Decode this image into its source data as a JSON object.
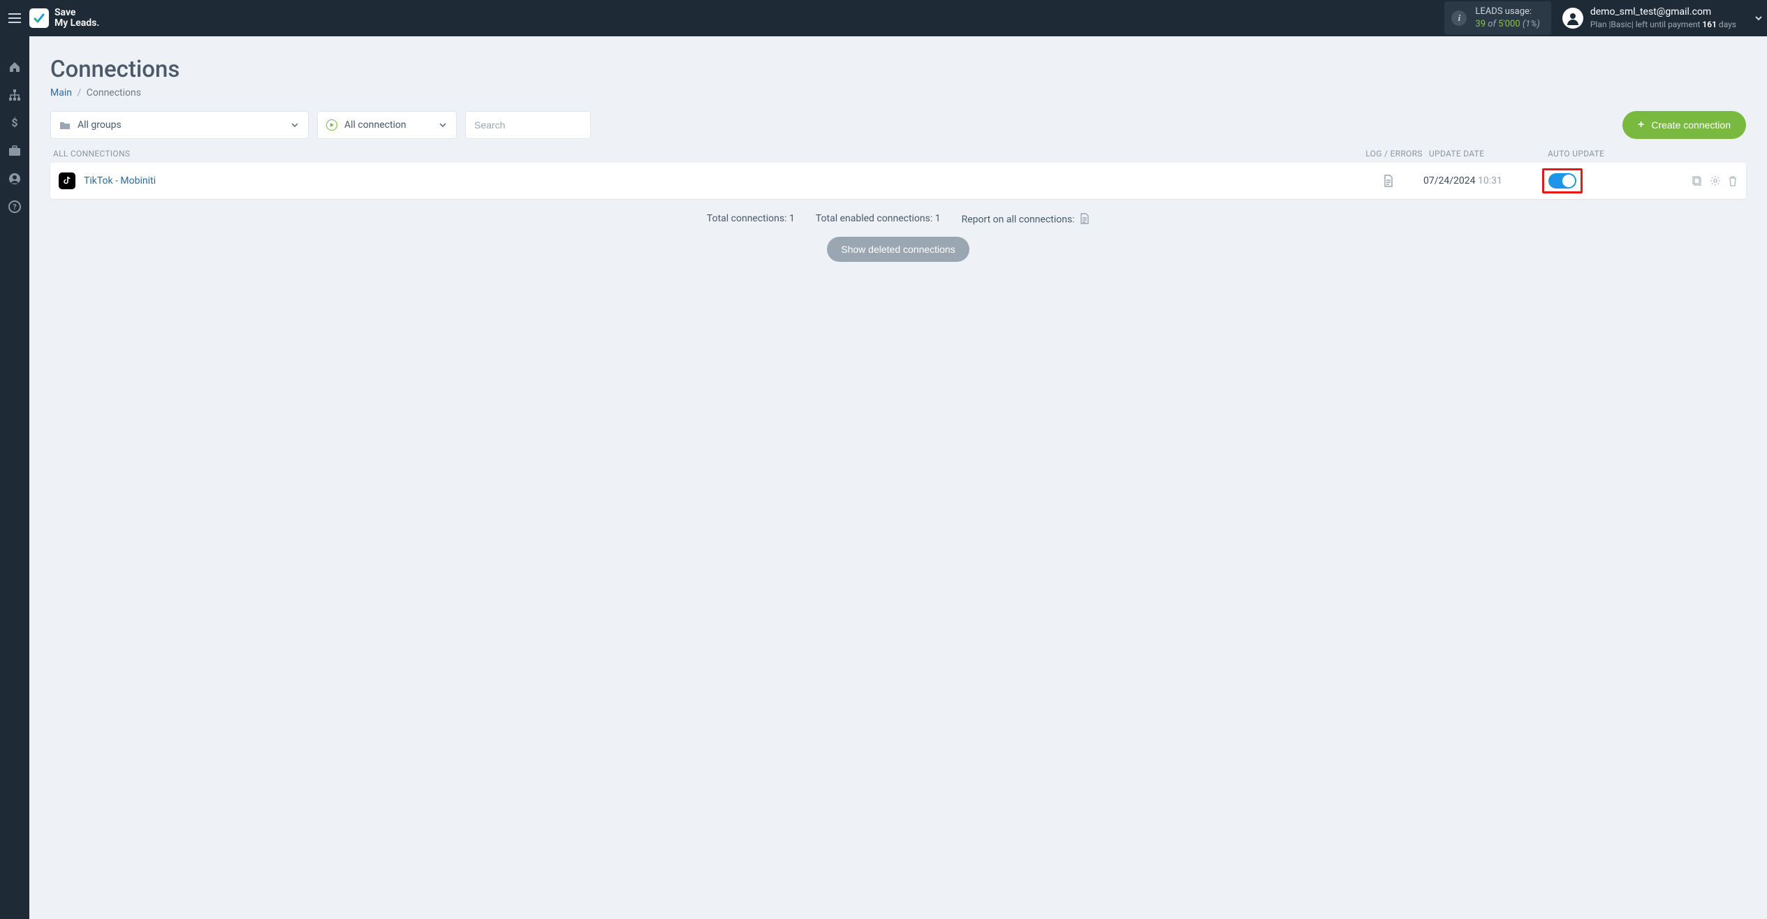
{
  "brand": {
    "line1": "Save",
    "line2": "My Leads."
  },
  "leads": {
    "label": "LEADS usage:",
    "used": "39",
    "of": "of",
    "total": "5'000",
    "pct": "(1%)"
  },
  "account": {
    "email": "demo_sml_test@gmail.com",
    "plan1": "Plan |",
    "plan2": "Basic",
    "plan3": "| left until payment",
    "days_n": "161",
    "days_w": "days"
  },
  "page": {
    "title": "Connections",
    "bc_main": "Main",
    "bc_current": "Connections"
  },
  "filters": {
    "groups": "All groups",
    "state": "All connection",
    "search_ph": "Search",
    "create": "Create connection"
  },
  "columns": {
    "all": "ALL CONNECTIONS",
    "log": "LOG / ERRORS",
    "date": "UPDATE DATE",
    "auto": "AUTO UPDATE"
  },
  "rows": [
    {
      "name": "TikTok - Mobiniti",
      "icon_lbl": "T",
      "date": "07/24/2024",
      "time": "10:31"
    }
  ],
  "summary": {
    "total_label": "Total connections:",
    "total_n": "1",
    "enabled_label": "Total enabled connections:",
    "enabled_n": "1",
    "report_label": "Report on all connections:"
  },
  "show_deleted": "Show deleted connections"
}
